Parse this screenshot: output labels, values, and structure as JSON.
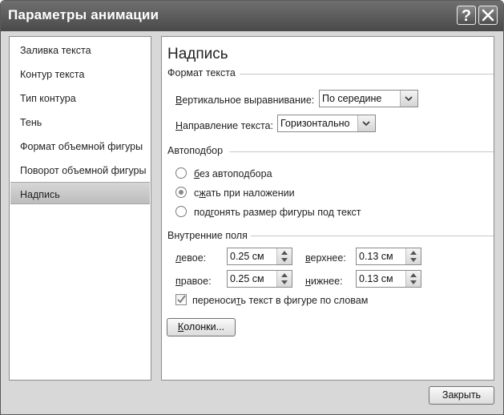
{
  "window": {
    "title": "Параметры анимации",
    "help_label": "?"
  },
  "sidebar": {
    "items": [
      {
        "label": "Заливка текста"
      },
      {
        "label": "Контур текста"
      },
      {
        "label": "Тип контура"
      },
      {
        "label": "Тень"
      },
      {
        "label": "Формат объемной фигуры"
      },
      {
        "label": "Поворот объемной фигуры"
      },
      {
        "label": "Надпись",
        "selected": true
      }
    ]
  },
  "main": {
    "heading": "Надпись",
    "text_format": {
      "title": "Формат текста",
      "vertical_align_label": "Вертикальное выравнивание:",
      "vertical_align_value": "По середине",
      "direction_label": "Направление текста:",
      "direction_value": "Горизонтально"
    },
    "autofit": {
      "title": "Автоподбор",
      "options": [
        {
          "label": "без автоподбора",
          "selected": false
        },
        {
          "label": "сжать при наложении",
          "selected": true
        },
        {
          "label": "подгонять размер фигуры под текст",
          "selected": false
        }
      ]
    },
    "margins": {
      "title": "Внутренние поля",
      "left_label": "левое:",
      "left_value": "0.25 см",
      "top_label": "верхнее:",
      "top_value": "0.13 см",
      "right_label": "правое:",
      "right_value": "0.25 см",
      "bottom_label": "нижнее:",
      "bottom_value": "0.13 см"
    },
    "wrap_text": {
      "label": "переносить текст в фигуре по словам",
      "checked": true
    },
    "columns_button": "Колонки..."
  },
  "footer": {
    "close_button": "Закрыть"
  }
}
